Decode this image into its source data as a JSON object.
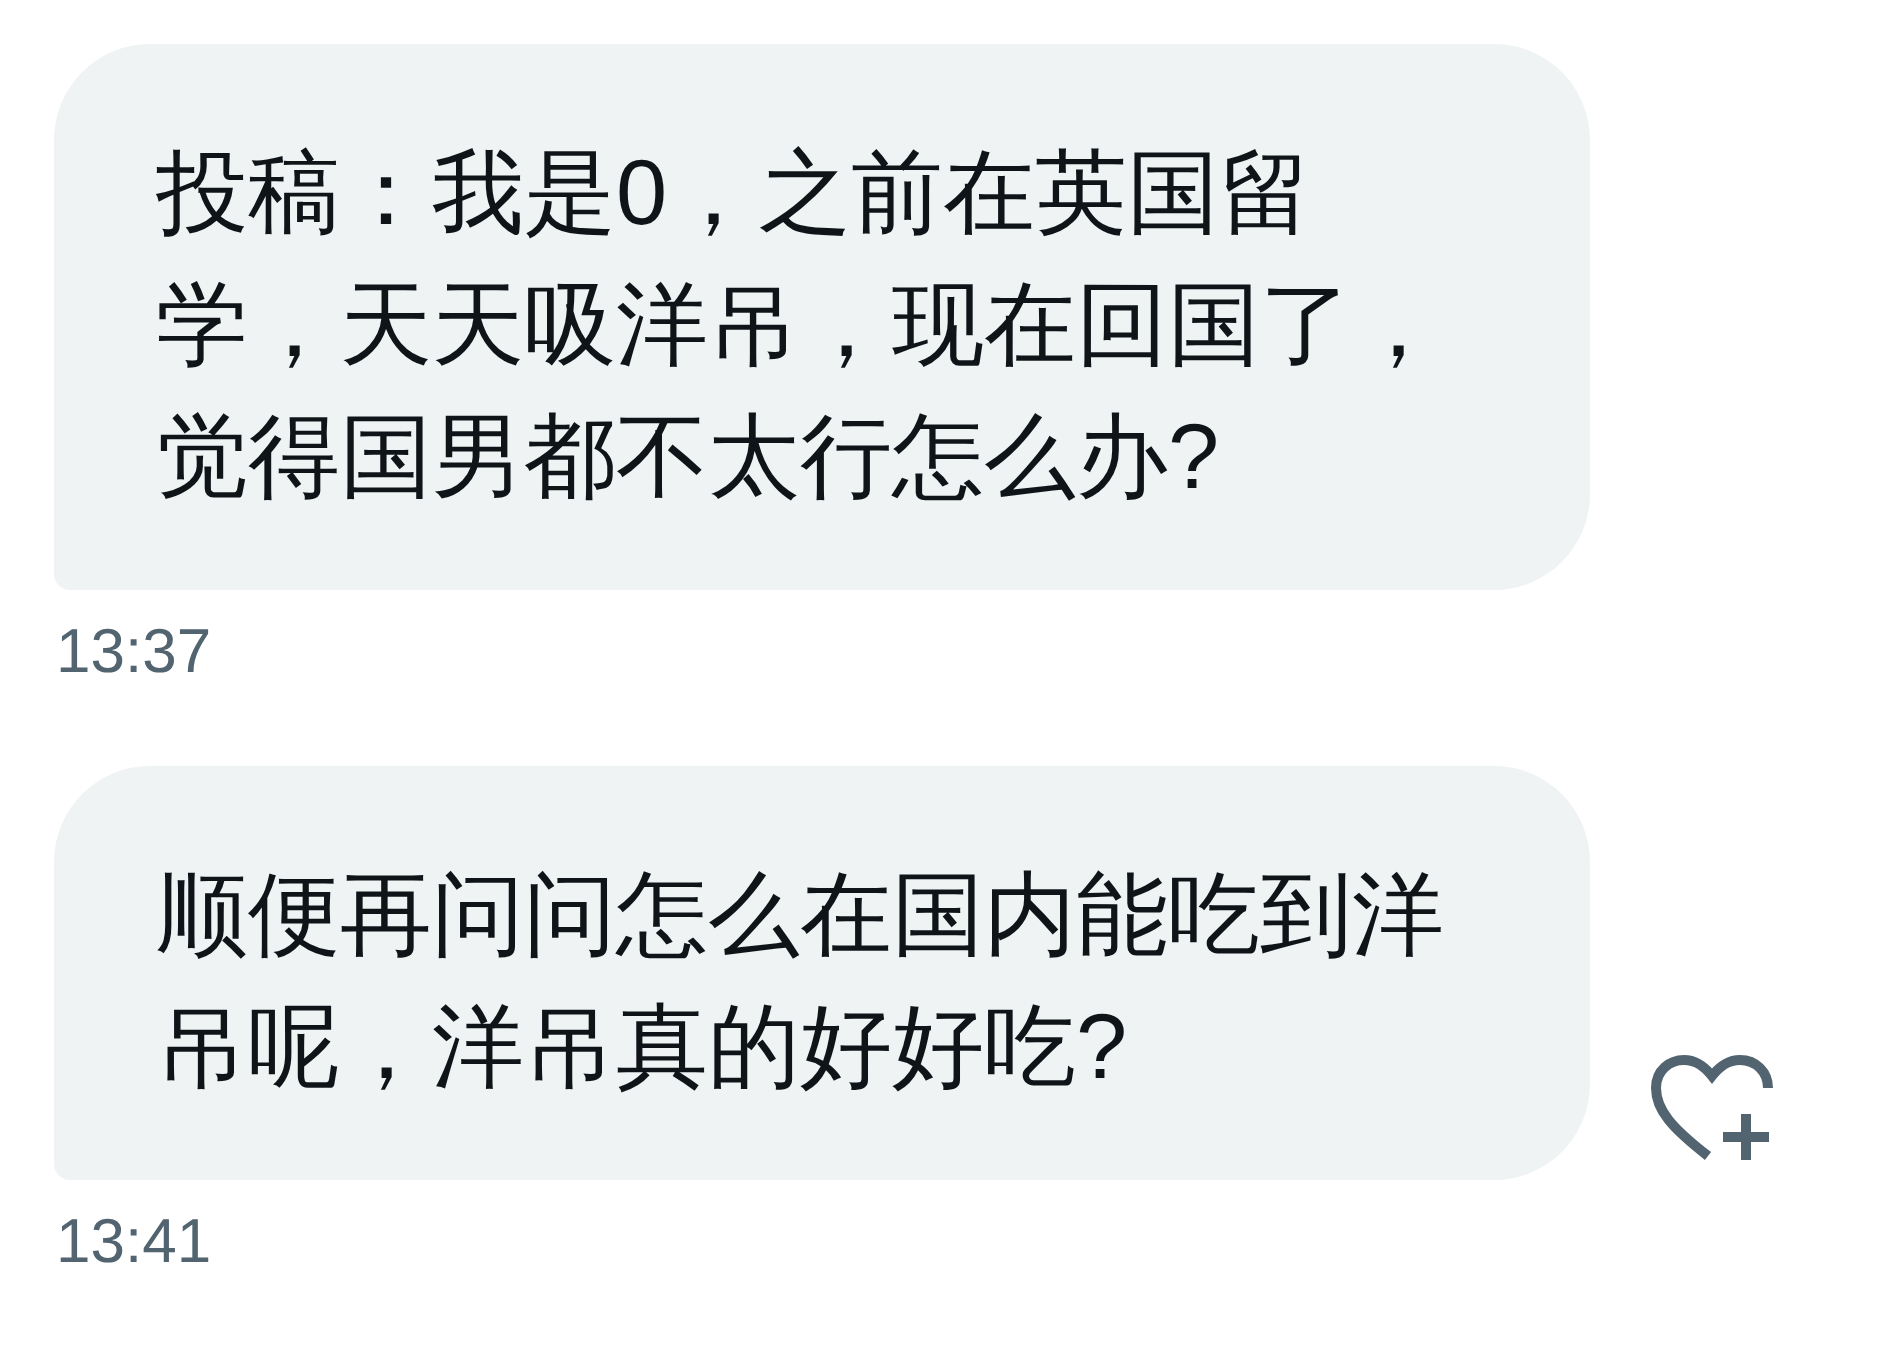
{
  "messages": [
    {
      "text": "投稿：我是0，之前在英国留学，天天吸洋吊，现在回国了，觉得国男都不太行怎么办?",
      "time": "13:37",
      "like_button": false
    },
    {
      "text": "顺便再问问怎么在国内能吃到洋吊呢，洋吊真的好好吃?",
      "time": "13:41",
      "like_button": true
    }
  ]
}
